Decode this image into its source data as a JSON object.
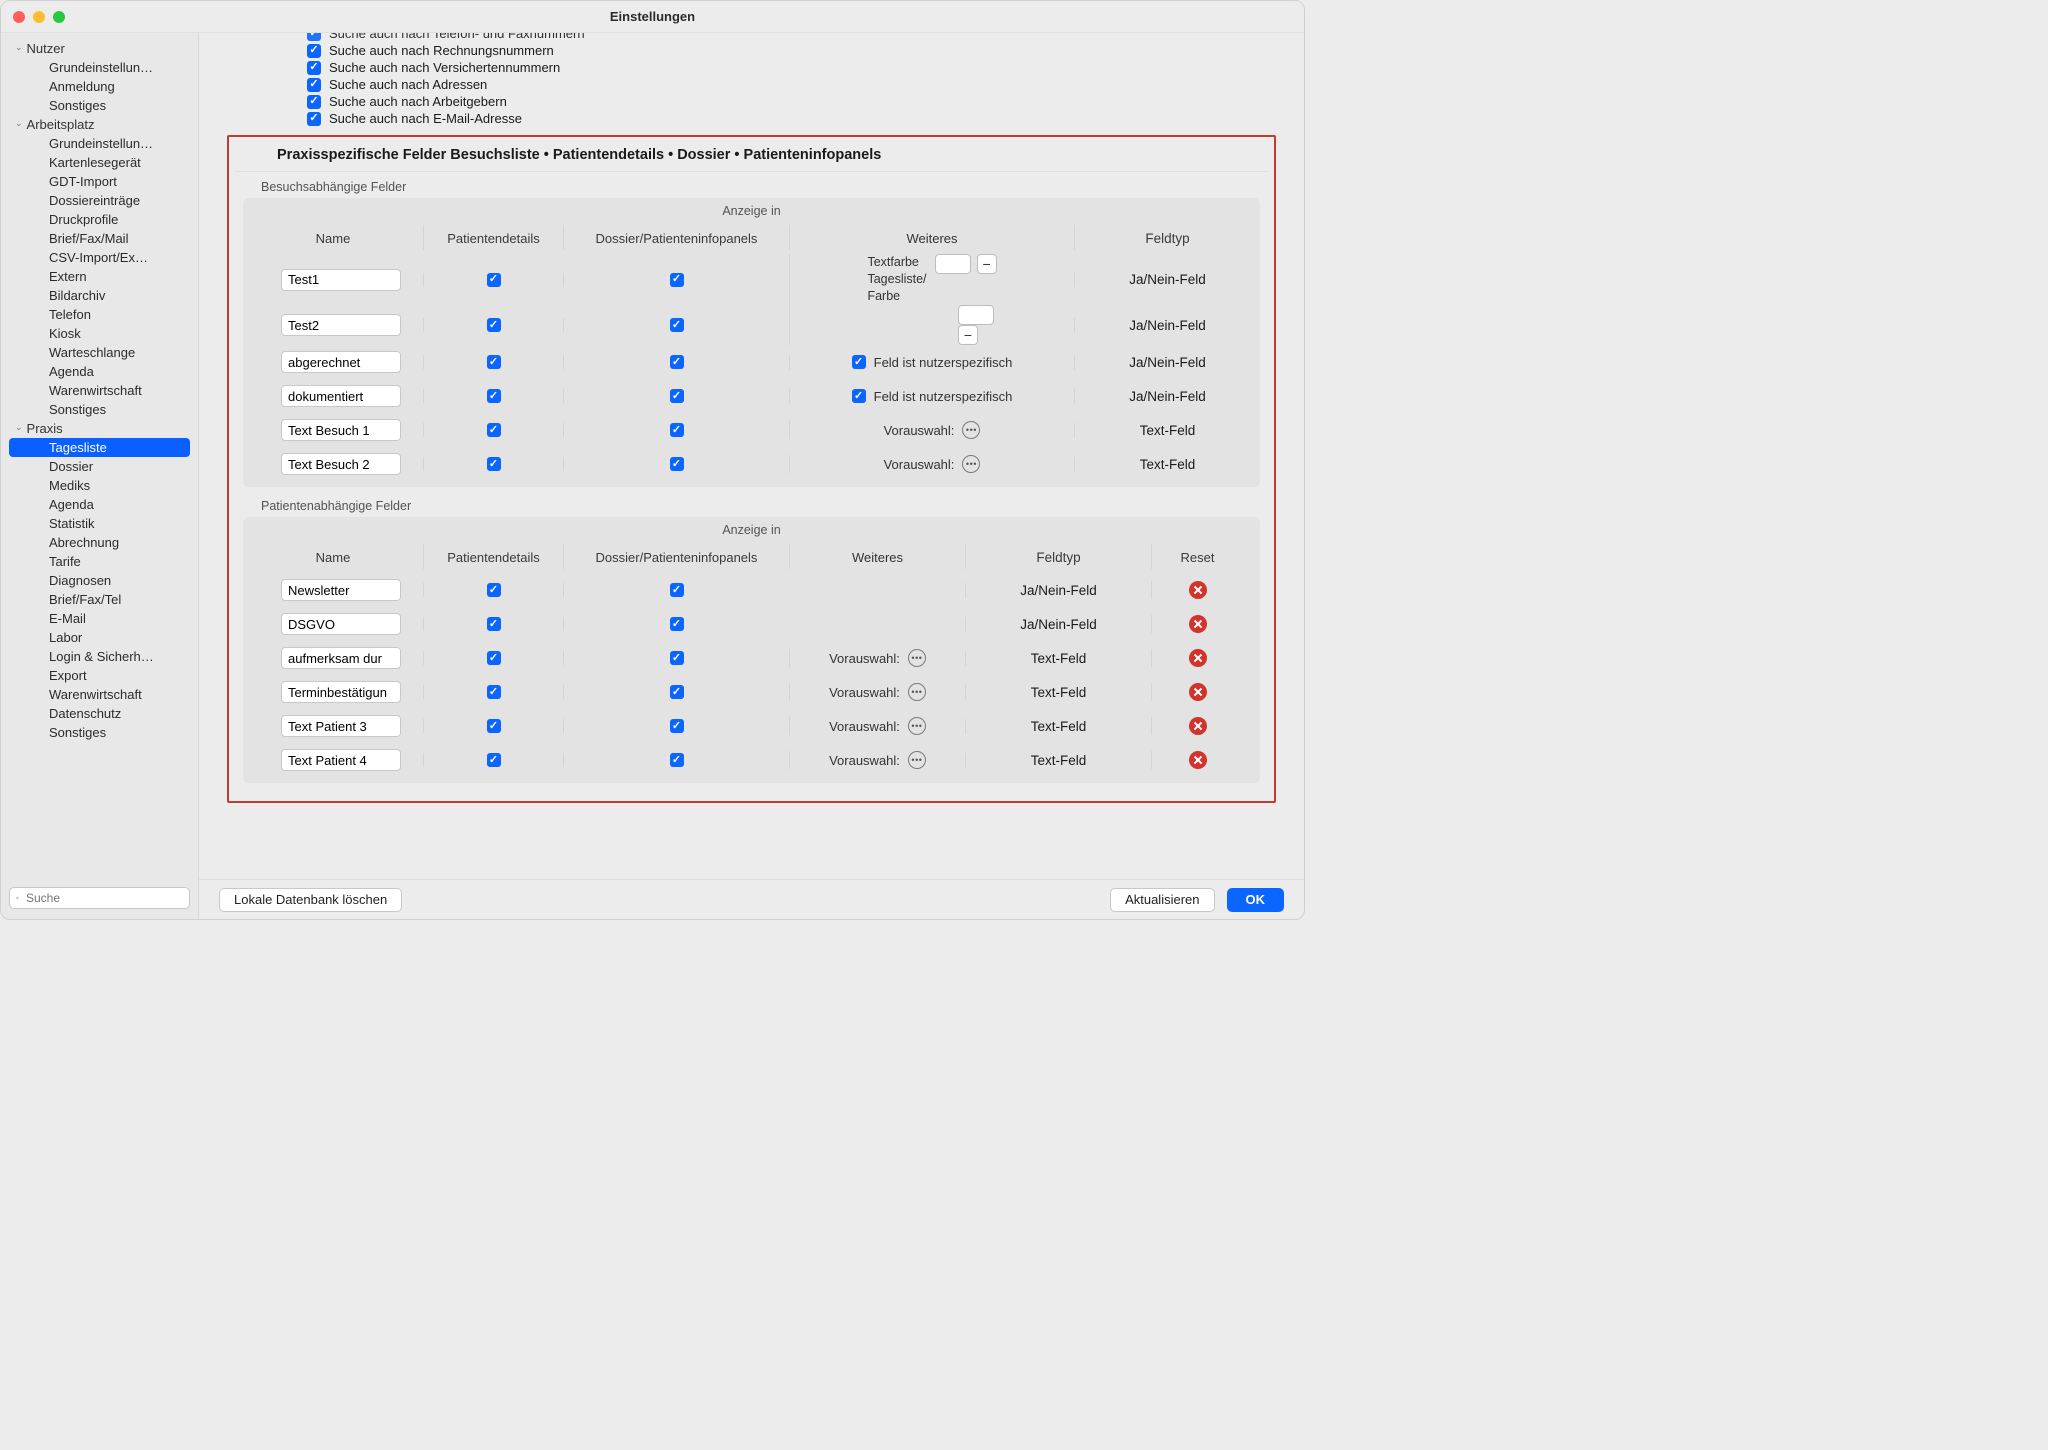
{
  "window": {
    "title": "Einstellungen"
  },
  "sidebar": {
    "groups": [
      {
        "label": "Nutzer",
        "items": [
          "Grundeinstellun…",
          "Anmeldung",
          "Sonstiges"
        ]
      },
      {
        "label": "Arbeitsplatz",
        "items": [
          "Grundeinstellun…",
          "Kartenlesegerät",
          "GDT-Import",
          "Dossiereinträge",
          "Druckprofile",
          "Brief/Fax/Mail",
          "CSV-Import/Ex…",
          "Extern",
          "Bildarchiv",
          "Telefon",
          "Kiosk",
          "Warteschlange",
          "Agenda",
          "Warenwirtschaft",
          "Sonstiges"
        ]
      },
      {
        "label": "Praxis",
        "items": [
          "Tagesliste",
          "Dossier",
          "Mediks",
          "Agenda",
          "Statistik",
          "Abrechnung",
          "Tarife",
          "Diagnosen",
          "Brief/Fax/Tel",
          "E-Mail",
          "Labor",
          "Login & Sicherh…",
          "Export",
          "Warenwirtschaft",
          "Datenschutz",
          "Sonstiges"
        ]
      }
    ],
    "selection": {
      "group": 2,
      "item": 0
    },
    "search_placeholder": "Suche"
  },
  "search_options": [
    "Suche auch nach Telefon- und Faxnummern",
    "Suche auch nach Rechnungsnummern",
    "Suche auch nach Versichertennummern",
    "Suche auch nach Adressen",
    "Suche auch nach Arbeitgebern",
    "Suche auch nach E-Mail-Adresse"
  ],
  "panel": {
    "title": "Praxisspezifische Felder Besuchsliste • Patientendetails • Dossier • Patienteninfopanels",
    "sect_visit_label": "Besuchsabhängige Felder",
    "sect_patient_label": "Patientenabhängige Felder",
    "anzeige_in": "Anzeige in",
    "cols": {
      "name": "Name",
      "pd": "Patientendetails",
      "di": "Dossier/Patienteninfopanels",
      "w": "Weiteres",
      "ft": "Feldtyp",
      "rs": "Reset"
    },
    "txt": {
      "textfarbe": "Textfarbe",
      "tagesliste_farbe": "Tagesliste/\nFarbe",
      "user_specific": "Feld ist nutzerspezifisch",
      "vorauswahl": "Vorauswahl:"
    },
    "visit_rows": [
      {
        "name": "Test1",
        "pd": true,
        "di": true,
        "w_type": "color",
        "ft": "Ja/Nein-Feld"
      },
      {
        "name": "Test2",
        "pd": true,
        "di": true,
        "w_type": "color2",
        "ft": "Ja/Nein-Feld"
      },
      {
        "name": "abgerechnet",
        "pd": true,
        "di": true,
        "w_type": "usercb",
        "ft": "Ja/Nein-Feld"
      },
      {
        "name": "dokumentiert",
        "pd": true,
        "di": true,
        "w_type": "usercb",
        "ft": "Ja/Nein-Feld"
      },
      {
        "name": "Text Besuch 1",
        "pd": true,
        "di": true,
        "w_type": "vorauswahl",
        "ft": "Text-Feld"
      },
      {
        "name": "Text Besuch 2",
        "pd": true,
        "di": true,
        "w_type": "vorauswahl",
        "ft": "Text-Feld"
      }
    ],
    "patient_rows": [
      {
        "name": "Newsletter",
        "pd": true,
        "di": true,
        "w_type": "none",
        "ft": "Ja/Nein-Feld"
      },
      {
        "name": "DSGVO",
        "pd": true,
        "di": true,
        "w_type": "none",
        "ft": "Ja/Nein-Feld"
      },
      {
        "name": "aufmerksam dur",
        "pd": true,
        "di": true,
        "w_type": "vorauswahl",
        "ft": "Text-Feld"
      },
      {
        "name": "Terminbestätigun",
        "pd": true,
        "di": true,
        "w_type": "vorauswahl",
        "ft": "Text-Feld"
      },
      {
        "name": "Text Patient 3",
        "pd": true,
        "di": true,
        "w_type": "vorauswahl",
        "ft": "Text-Feld"
      },
      {
        "name": "Text Patient 4",
        "pd": true,
        "di": true,
        "w_type": "vorauswahl",
        "ft": "Text-Feld"
      }
    ]
  },
  "footer": {
    "local_db": "Lokale Datenbank löschen",
    "refresh": "Aktualisieren",
    "ok": "OK"
  }
}
